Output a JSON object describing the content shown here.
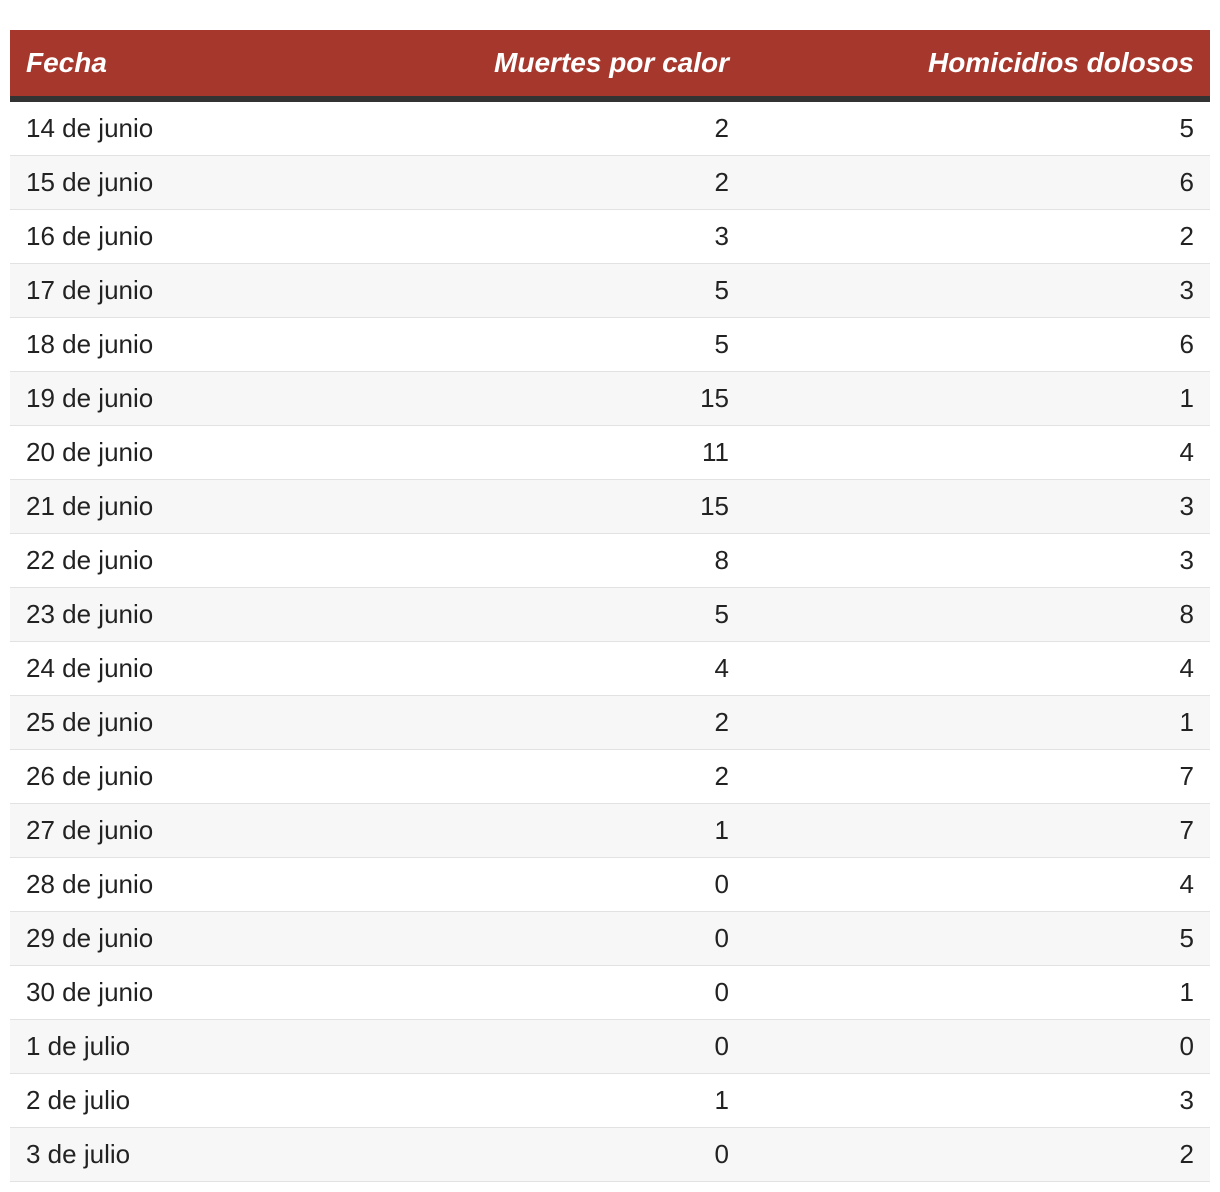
{
  "chart_data": {
    "type": "table",
    "columns": [
      "Fecha",
      "Muertes por calor",
      "Homicidios dolosos"
    ],
    "rows": [
      [
        "14 de junio",
        "2",
        "5"
      ],
      [
        "15 de junio",
        "2",
        "6"
      ],
      [
        "16 de junio",
        "3",
        "2"
      ],
      [
        "17 de junio",
        "5",
        "3"
      ],
      [
        "18 de junio",
        "5",
        "6"
      ],
      [
        "19 de junio",
        "15",
        "1"
      ],
      [
        "20 de junio",
        "11",
        "4"
      ],
      [
        "21 de junio",
        "15",
        "3"
      ],
      [
        "22 de junio",
        "8",
        "3"
      ],
      [
        "23 de junio",
        "5",
        "8"
      ],
      [
        "24 de junio",
        "4",
        "4"
      ],
      [
        "25 de junio",
        "2",
        "1"
      ],
      [
        "26 de junio",
        "2",
        "7"
      ],
      [
        "27 de junio",
        "1",
        "7"
      ],
      [
        "28 de junio",
        "0",
        "4"
      ],
      [
        "29 de junio",
        "0",
        "5"
      ],
      [
        "30 de junio",
        "0",
        "1"
      ],
      [
        "1 de julio",
        "0",
        "0"
      ],
      [
        "2 de julio",
        "1",
        "3"
      ],
      [
        "3 de julio",
        "0",
        "2"
      ]
    ]
  },
  "colors": {
    "header_bg": "#a6372c",
    "header_text": "#ffffff",
    "header_rule": "#333333",
    "row_alt_bg": "#f7f7f7"
  }
}
